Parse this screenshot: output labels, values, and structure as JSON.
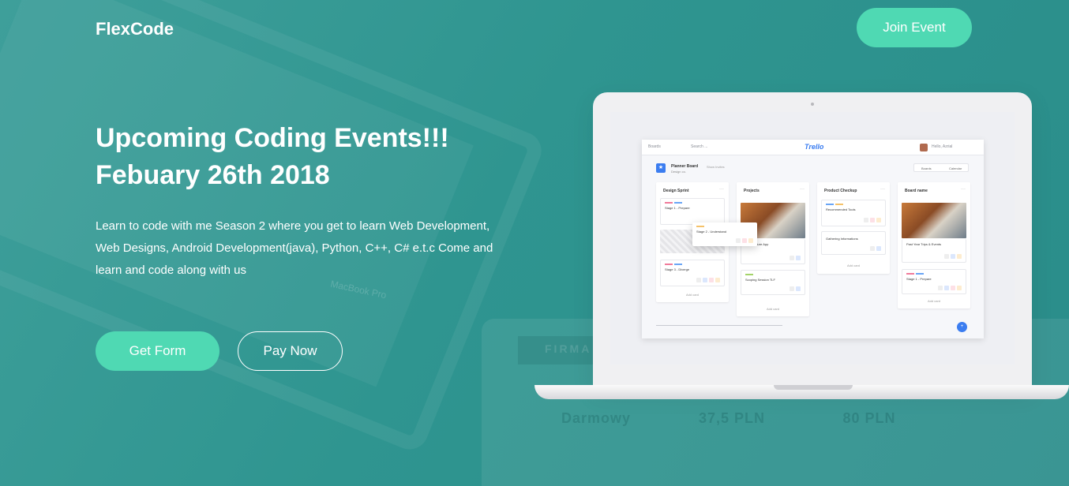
{
  "header": {
    "brand": "FlexCode",
    "join_label": "Join Event"
  },
  "hero": {
    "title_line1": "Upcoming Coding Events!!!",
    "title_line2": "Febuary 26th 2018",
    "description": "Learn to code with me Season 2 where you get to learn Web Development, Web Designs, Android Development(java), Python, C++, C# e.t.c Come and learn and code along with us",
    "primary_cta": "Get Form",
    "secondary_cta": "Pay Now"
  },
  "background": {
    "tablet_brand": "FIRMA",
    "laptop_brand": "MacBook Pro",
    "prices": [
      {
        "amount": "Darmowy"
      },
      {
        "amount": "37,5 PLN"
      },
      {
        "amount": "80 PLN"
      }
    ]
  },
  "mockup": {
    "topbar": {
      "boards": "Boards",
      "search": "Search ...",
      "logo": "Trello",
      "user": "Hello, Azrial"
    },
    "board": {
      "title": "Planner Board",
      "subtitle": "Design co.",
      "invite": "Show Invites",
      "tabs": [
        "Boards",
        "Calendar"
      ]
    },
    "columns": [
      {
        "title": "Design Sprint",
        "cards": [
          "Stage 1 - Prepare",
          "Stage 3 - Diverge"
        ],
        "add": "Add card"
      },
      {
        "title": "Projects",
        "cards": [
          "Architecture App",
          "Scoping Session TLF"
        ],
        "add": "Add card"
      },
      {
        "title": "Product Checkup",
        "cards": [
          "Recommended Tools",
          "Gathering Informations"
        ],
        "add": "Add card"
      },
      {
        "title": "Board name",
        "cards": [
          "Past Year Trips & Events",
          "Stage 1 - Prepare"
        ],
        "add": "Add card"
      }
    ],
    "floating_card": "Stage 2 - Understand"
  },
  "colors": {
    "background": "#2f9590",
    "accent": "#4fd9b3",
    "app_blue": "#3b7df0"
  }
}
